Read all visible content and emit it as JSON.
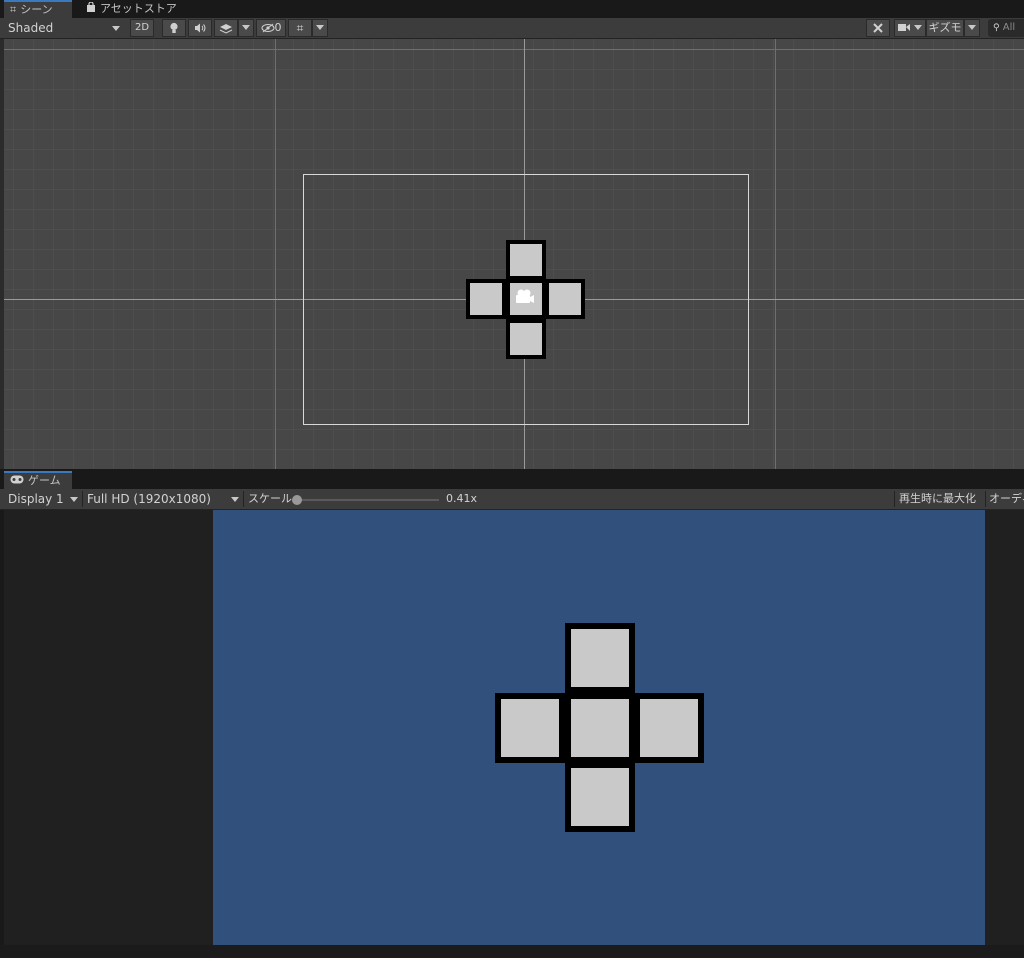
{
  "scene_panel": {
    "tabs": [
      {
        "icon": "grid-icon",
        "label": "シーン",
        "active": true
      },
      {
        "icon": "shopping-bag-icon",
        "label": "アセットストア",
        "active": false
      }
    ],
    "toolbar": {
      "shading_mode": "Shaded",
      "mode_2d_label": "2D",
      "hidden_count": "0",
      "gizmos_label": "ギズモ",
      "search_placeholder": "All"
    }
  },
  "game_panel": {
    "tab": {
      "icon": "gamepad-icon",
      "label": "ゲーム"
    },
    "toolbar": {
      "display": "Display 1",
      "resolution": "Full HD (1920x1080)",
      "scale_label": "スケール",
      "scale_value": "0.41x",
      "scale_fraction": 0.0,
      "maximize_label": "再生時に最大化",
      "audio_label": "オーディ"
    },
    "background_color": "#31507b"
  },
  "colors": {
    "accent": "#3a79bb",
    "tile_fill": "#c9c9c9",
    "tile_border": "#000000",
    "panel_bg": "#3c3c3c",
    "scene_bg": "#474747"
  }
}
